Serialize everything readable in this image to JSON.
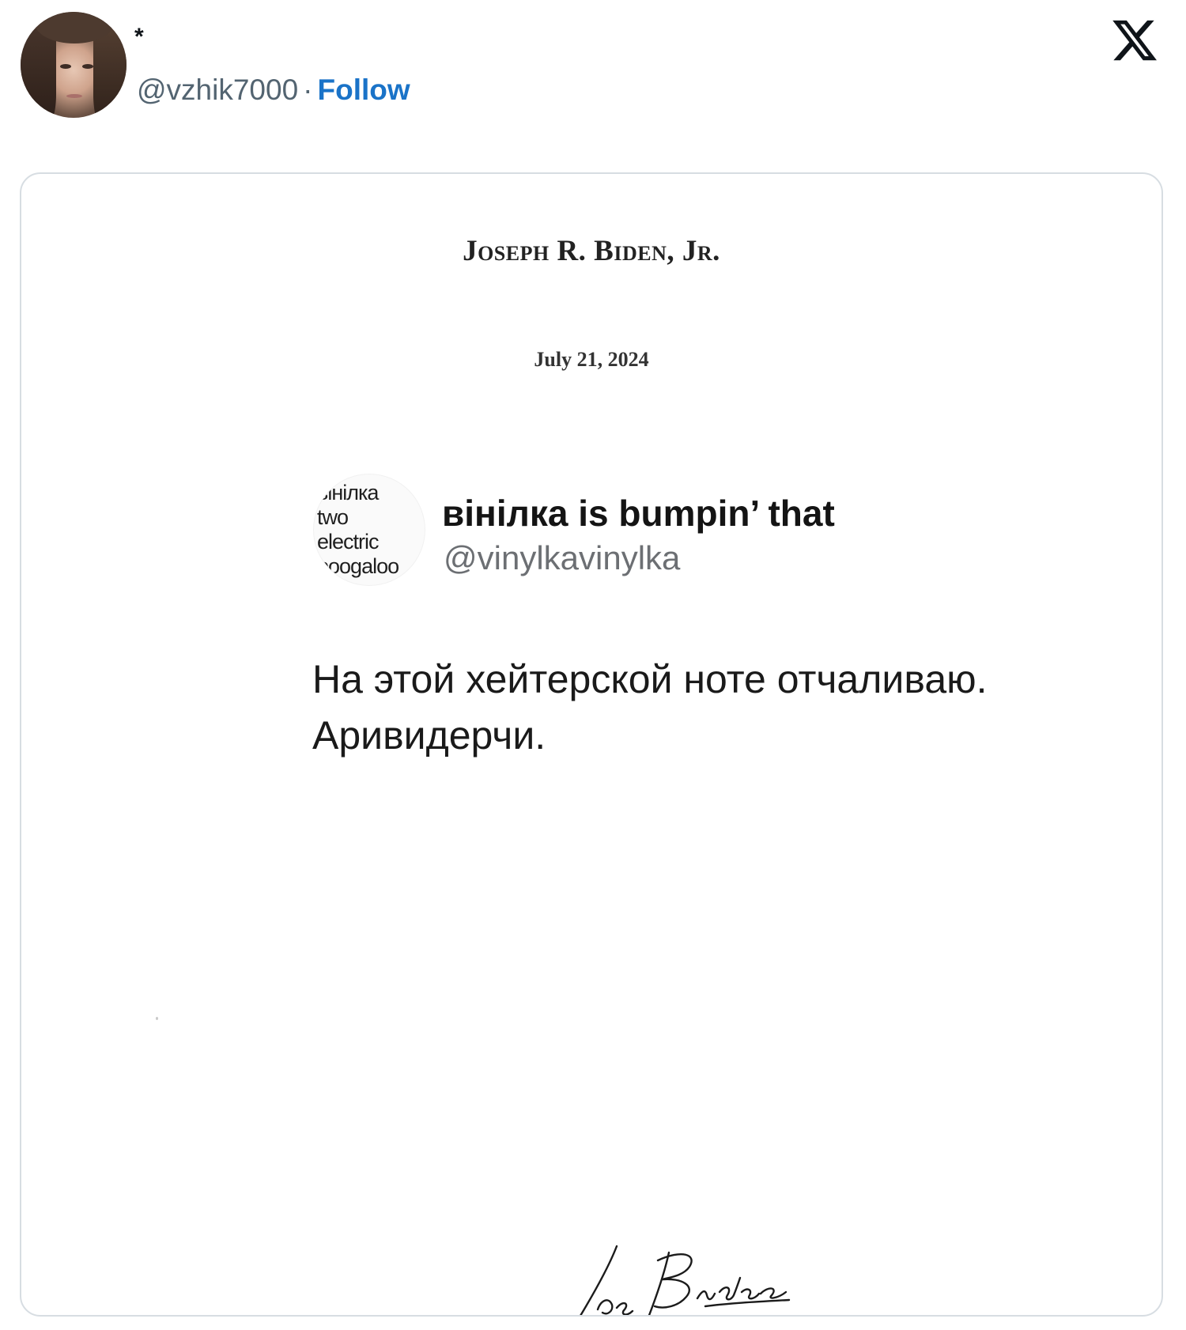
{
  "author": {
    "display_name": "*",
    "handle": "@vzhik7000",
    "separator": "·",
    "follow_label": "Follow"
  },
  "platform_icon": "x-logo-icon",
  "colors": {
    "follow_link": "#1a73c8",
    "handle_grey": "#536471",
    "card_border": "#d7dde2"
  },
  "letter": {
    "letterhead": "Joseph R. Biden, Jr.",
    "date": "July 21, 2024",
    "signature": "Jos. Biden"
  },
  "quoted_post": {
    "avatar_text": "вінілка\ntwo\nelectric\nboogaloo",
    "display_name": "вінілка is bumpin’ that",
    "handle": "@vinylkavinylka",
    "body_lines": [
      "На этой хейтерской ноте отчаливаю.",
      "Аривидерчи."
    ]
  }
}
